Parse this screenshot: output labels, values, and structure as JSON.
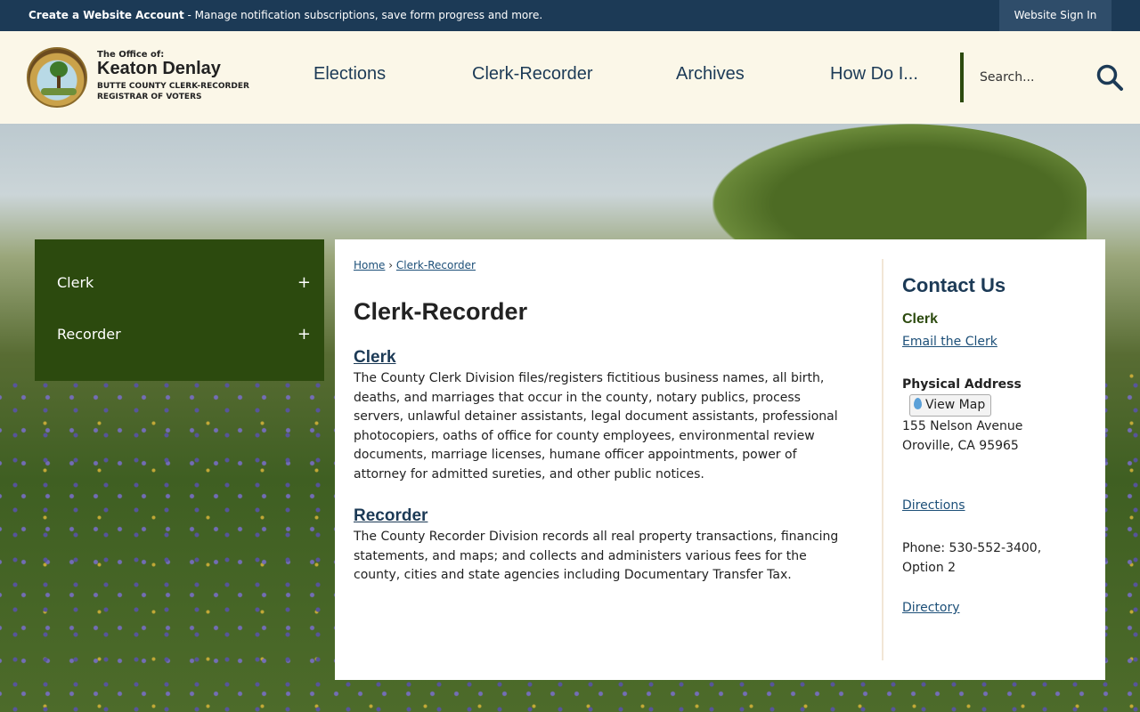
{
  "topbar": {
    "promo_bold": "Create a Website Account",
    "promo_text": " - Manage notification subscriptions, save form progress and more.",
    "signin": "Website Sign In"
  },
  "logo": {
    "line1": "The Office of:",
    "line2": "Keaton Denlay",
    "line3": "BUTTE COUNTY CLERK-RECORDER",
    "line4": "REGISTRAR OF VOTERS"
  },
  "nav": {
    "items": [
      "Elections",
      "Clerk-Recorder",
      "Archives",
      "How Do I..."
    ]
  },
  "search": {
    "placeholder": "Search..."
  },
  "sidenav": {
    "items": [
      {
        "label": "Clerk",
        "expander": "+"
      },
      {
        "label": "Recorder",
        "expander": "+"
      }
    ]
  },
  "breadcrumb": {
    "home": "Home",
    "sep": "›",
    "current": "Clerk-Recorder"
  },
  "main": {
    "title": "Clerk-Recorder",
    "sections": [
      {
        "title": "Clerk",
        "body": "The County Clerk Division files/registers fictitious business names, all birth, deaths, and marriages that occur in the county, notary publics, process servers, unlawful detainer assistants, legal document assistants, professional photocopiers, oaths of office for county employees, environmental review documents, marriage licenses, humane officer appointments, power of attorney for admitted sureties, and other public notices."
      },
      {
        "title": "Recorder",
        "body": "The County Recorder Division records all real property transactions, financing statements, and maps; and collects and administers various fees for the county, cities and state agencies including Documentary Transfer Tax."
      }
    ]
  },
  "contact": {
    "heading": "Contact Us",
    "subheading": "Clerk",
    "email_link": "Email the Clerk",
    "address_label": "Physical Address",
    "map_button": "View Map",
    "street": "155 Nelson Avenue",
    "city": "Oroville, CA 95965",
    "directions": "Directions",
    "phone_line1": "Phone: 530-552-3400,",
    "phone_line2": "Option 2",
    "directory": "Directory"
  },
  "colors": {
    "navy": "#1c3a56",
    "olive": "#2c4a0e",
    "cream": "#fbf7e8",
    "link": "#1c4f78"
  }
}
